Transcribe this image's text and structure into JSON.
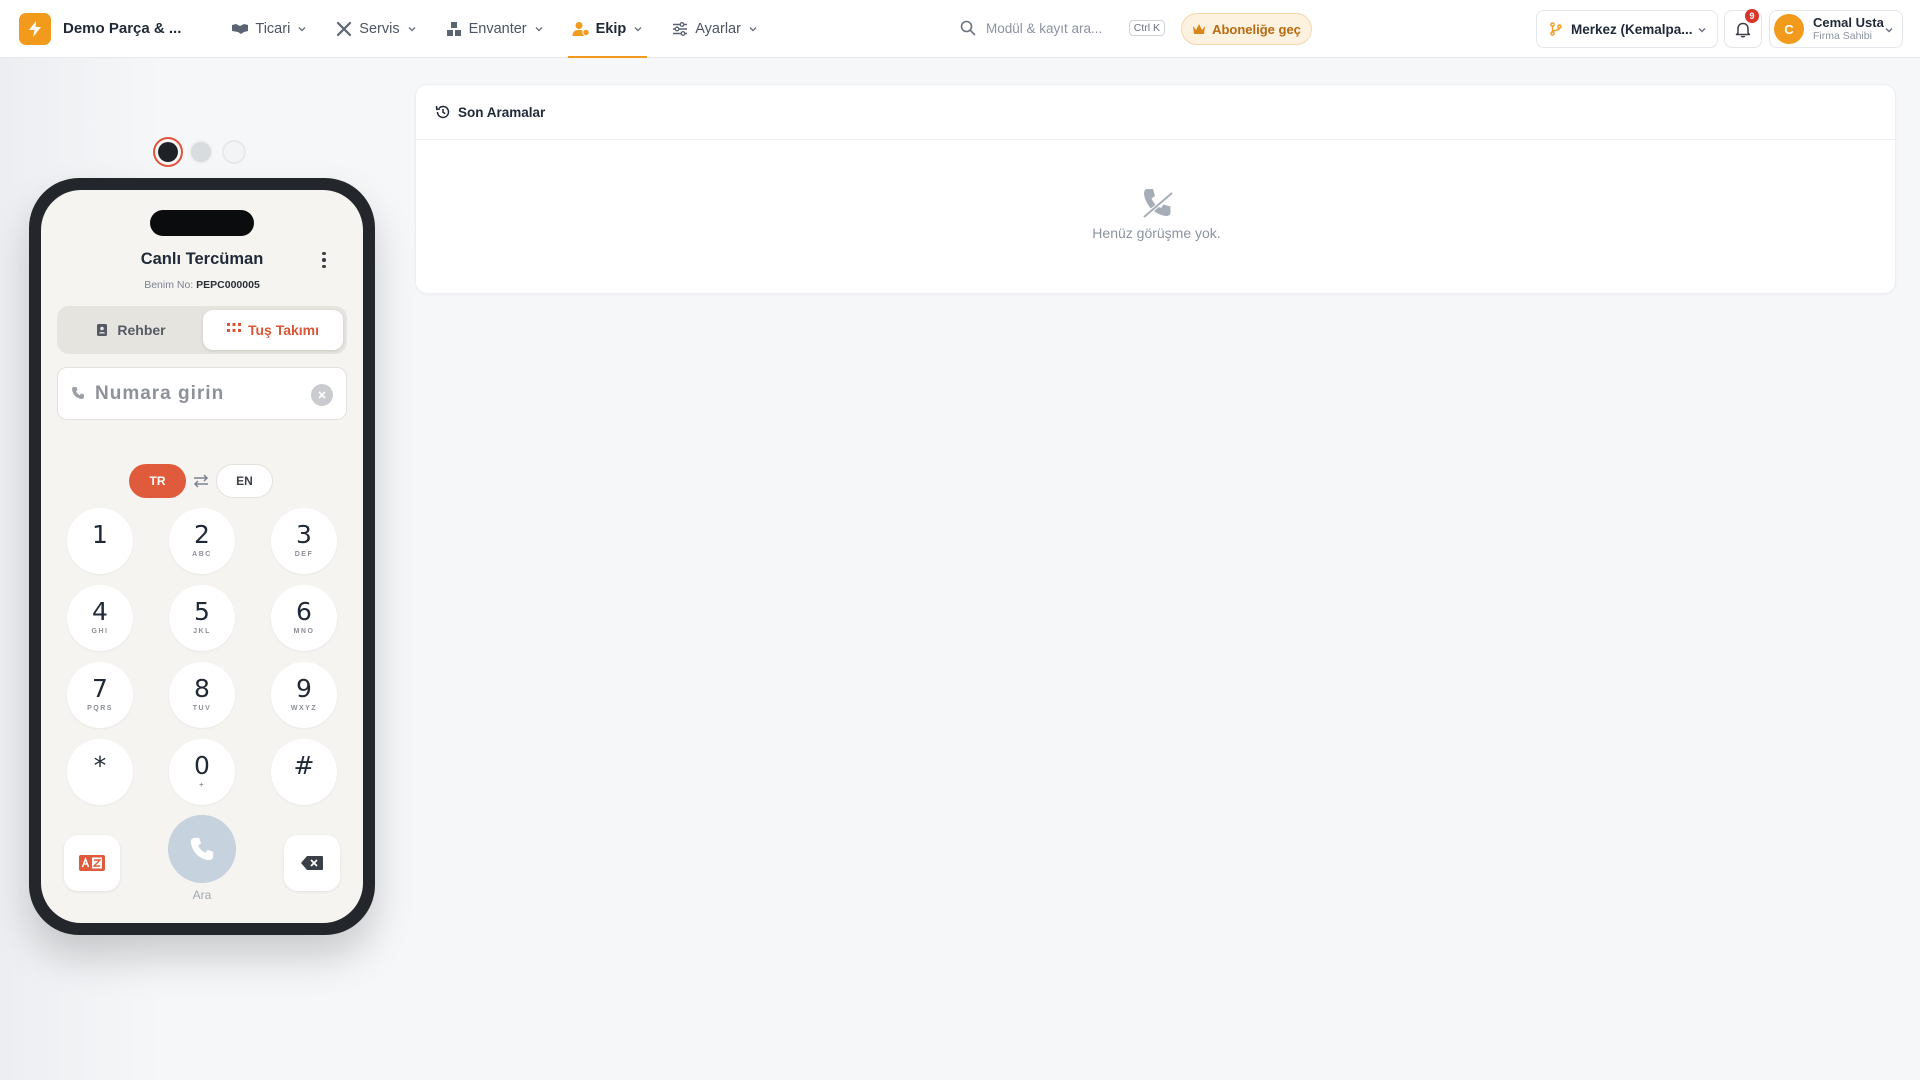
{
  "brand": {
    "name": "Demo Parça & ..."
  },
  "nav": [
    {
      "label": "Ticari",
      "icon": "handshake-icon"
    },
    {
      "label": "Servis",
      "icon": "wrench-icon"
    },
    {
      "label": "Envanter",
      "icon": "boxes-icon"
    },
    {
      "label": "Ekip",
      "icon": "team-icon",
      "active": true
    },
    {
      "label": "Ayarlar",
      "icon": "sliders-icon"
    }
  ],
  "search": {
    "placeholder": "Modül & kayıt ara...",
    "shortcut": "Ctrl K"
  },
  "subscribe": {
    "label": "Aboneliğe geç"
  },
  "branch": {
    "label": "Merkez (Kemalpa..."
  },
  "notifications": {
    "count": "9"
  },
  "user": {
    "initial": "C",
    "name": "Cemal Usta",
    "role": "Firma Sahibi"
  },
  "colors": {
    "accent": "#f29a1b",
    "primary": "#df5b3b",
    "badge": "#d9342b"
  },
  "phone": {
    "title": "Canlı Tercüman",
    "my_number_label": "Benim No:",
    "my_number": "PEPC000005",
    "tabs": {
      "contacts": "Rehber",
      "keypad": "Tuş Takımı",
      "active": "keypad"
    },
    "number_placeholder": "Numara girin",
    "languages": {
      "source": "TR",
      "target": "EN"
    },
    "keys": [
      {
        "digit": "1",
        "letters": ""
      },
      {
        "digit": "2",
        "letters": "ABC"
      },
      {
        "digit": "3",
        "letters": "DEF"
      },
      {
        "digit": "4",
        "letters": "GHI"
      },
      {
        "digit": "5",
        "letters": "JKL"
      },
      {
        "digit": "6",
        "letters": "MNO"
      },
      {
        "digit": "7",
        "letters": "PQRS"
      },
      {
        "digit": "8",
        "letters": "TUV"
      },
      {
        "digit": "9",
        "letters": "WXYZ"
      },
      {
        "digit": "*",
        "letters": ""
      },
      {
        "digit": "0",
        "letters": "+"
      },
      {
        "digit": "#",
        "letters": ""
      }
    ],
    "call_label": "Ara"
  },
  "recent_calls": {
    "title": "Son Aramalar",
    "empty_text": "Henüz görüşme yok."
  }
}
